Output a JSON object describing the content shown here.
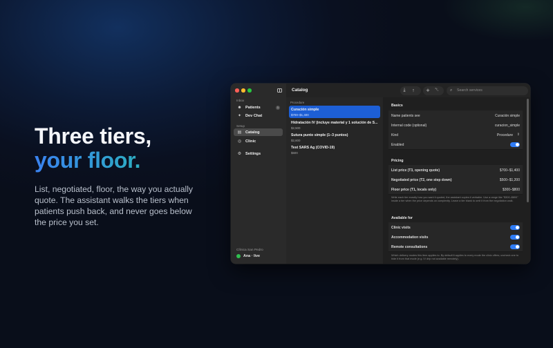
{
  "hero": {
    "title_line1": "Three tiers,",
    "title_line2": "your floor.",
    "body": "List, negotiated, floor, the way you actually quote. The assistant walks the tiers when patients push back, and never goes below the price you set."
  },
  "sidebar": {
    "sections": [
      {
        "label": "Inbox",
        "items": [
          {
            "label": "Patients",
            "icon": "people-icon",
            "badge": "1"
          },
          {
            "label": "Dev Chat",
            "icon": "wand-icon"
          }
        ]
      },
      {
        "label": "Setup",
        "items": [
          {
            "label": "Catalog",
            "icon": "catalog-icon",
            "active": true
          },
          {
            "label": "Clinic",
            "icon": "globe-icon"
          }
        ]
      }
    ],
    "settings_label": "Settings",
    "clinic_name": "Clínica San Pedro",
    "user_status": "Ana · live"
  },
  "toolbar": {
    "title": "Catalog",
    "search_placeholder": "Search services"
  },
  "list": {
    "section_label": "Procedure",
    "items": [
      {
        "name": "Curación simple",
        "price": "$700–$1,400",
        "selected": true
      },
      {
        "name": "Hidratación IV (incluye material y 1 solución de S...",
        "price": "$2,500"
      },
      {
        "name": "Sutura punto simple (1–3 puntos)",
        "price": "$2,600"
      },
      {
        "name": "Test SARS Ag (COVID-19)",
        "price": "$600"
      }
    ]
  },
  "detail": {
    "basics": {
      "heading": "Basics",
      "rows": [
        {
          "key": "Name patients see",
          "value": "Curación simple"
        },
        {
          "key": "Internal code (optional)",
          "value": "curacion_simple"
        },
        {
          "key": "Kind",
          "value": "Procedure"
        },
        {
          "key": "Enabled",
          "toggle": true
        }
      ]
    },
    "pricing": {
      "heading": "Pricing",
      "rows": [
        {
          "key": "List price (T3, opening quote)",
          "value": "$700–$1,400"
        },
        {
          "key": "Negotiated price (T2, one step down)",
          "value": "$500–$1,200"
        },
        {
          "key": "Floor price (T1, locals only)",
          "value": "$300–$800"
        }
      ],
      "note": "Write each tier exactly how you want it quoted, the assistant copies it verbatim. Use a range like \"$300–$800\" inside a tier when the price depends on complexity. Leave a tier blank to omit it from the negotiation walk."
    },
    "available": {
      "heading": "Available for",
      "rows": [
        {
          "key": "Clinic visits",
          "toggle": true
        },
        {
          "key": "Accommodation visits",
          "toggle": true
        },
        {
          "key": "Remote consultations",
          "toggle": true
        }
      ],
      "note": "Which delivery modes this item applies to. By default it applies to every mode the clinic offers; uncheck one to hide it from that mode (e.g. IV drip not available remotely)."
    }
  },
  "colors": {
    "accent": "#2f7cf6",
    "selected_row": "#1d5fd6",
    "live_dot": "#30c050"
  }
}
